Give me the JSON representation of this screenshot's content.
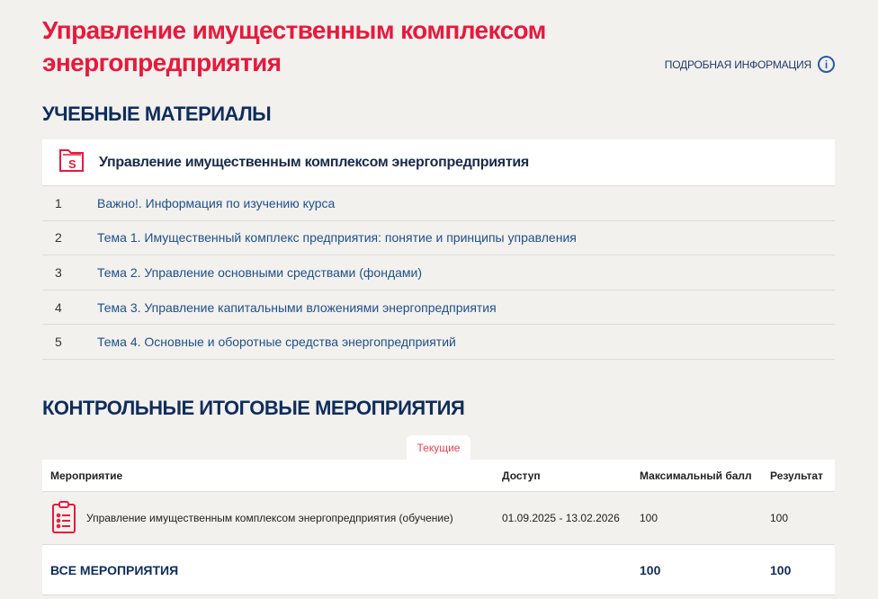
{
  "header": {
    "title": "Управление имущественным комплексом энергопредприятия",
    "more_info": "ПОДРОБНАЯ ИНФОРМАЦИЯ"
  },
  "materials": {
    "heading": "УЧЕБНЫЕ МАТЕРИАЛЫ",
    "course_title": "Управление имущественным комплексом энергопредприятия",
    "items": [
      {
        "n": "1",
        "label": "Важно!. Информация по изучению курса"
      },
      {
        "n": "2",
        "label": "Тема 1. Имущественный комплекс предприятия: понятие и принципы управления"
      },
      {
        "n": "3",
        "label": "Тема 2. Управление основными средствами (фондами)"
      },
      {
        "n": "4",
        "label": "Тема 3. Управление капитальными вложениями энергопредприятия"
      },
      {
        "n": "5",
        "label": "Тема 4. Основные и оборотные средства энергопредприятий"
      }
    ]
  },
  "control": {
    "heading": "КОНТРОЛЬНЫЕ ИТОГОВЫЕ МЕРОПРИЯТИЯ",
    "tab": "Текущие",
    "columns": [
      "Мероприятие",
      "Доступ",
      "Максимальный балл",
      "Результат"
    ],
    "rows": [
      {
        "name": "Управление имущественным комплексом энергопредприятия (обучение)",
        "access": "01.09.2025 - 13.02.2026",
        "max": "100",
        "result": "100"
      }
    ],
    "total": {
      "label": "ВСЕ МЕРОПРИЯТИЯ",
      "max": "100",
      "result": "100"
    }
  }
}
